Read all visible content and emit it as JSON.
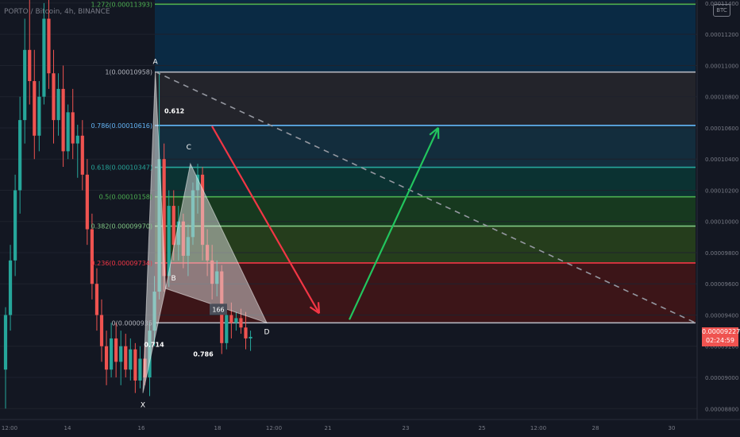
{
  "header": {
    "symbol": "PORTO / Bitcoin, 4h, BINANCE"
  },
  "axis": {
    "currency_badge": "BTC",
    "price_ticks": [
      "0.00011400",
      "0.00011200",
      "0.00011000",
      "0.00010800",
      "0.00010600",
      "0.00010400",
      "0.00010200",
      "0.00010000",
      "0.00009800",
      "0.00009600",
      "0.00009400",
      "0.00009200",
      "0.00009000",
      "0.00008800"
    ],
    "time_ticks": [
      "12:00",
      "14",
      "16",
      "18",
      "12:00",
      "21",
      "23",
      "25",
      "12:00",
      "28",
      "30"
    ],
    "last_price": "0.00009227",
    "countdown": "02:24:59"
  },
  "colors": {
    "background": "#131722",
    "up": "#26a69a",
    "down": "#ef5350",
    "arrow_down": "#f23645",
    "arrow_up": "#22c55e",
    "harmonic_fill": "#e0e0e0"
  },
  "chart_data": {
    "type": "candlestick",
    "y_range": [
      8.73e-05,
      0.0001142
    ],
    "fib_levels": [
      {
        "ratio": "1.272",
        "label": "1.272(0.00011393)",
        "value": 0.00011393,
        "line": "#4caf50",
        "fill": "#0a2a44"
      },
      {
        "ratio": "1",
        "label": "1(0.00010958)",
        "value": 0.00010958,
        "line": "#b2b5be",
        "fill": "#0a2a44"
      },
      {
        "ratio": "0.786",
        "label": "0.786(0.00010616)",
        "value": 0.00010616,
        "line": "#64b5f6",
        "fill": "#23242b"
      },
      {
        "ratio": "0.618",
        "label": "0.618(0.00010347)",
        "value": 0.00010347,
        "line": "#26a69a",
        "fill": "#132d3d"
      },
      {
        "ratio": "0.5",
        "label": "0.5(0.00010158)",
        "value": 0.00010158,
        "line": "#4caf50",
        "fill": "#0b3232"
      },
      {
        "ratio": "0.382",
        "label": "0.382(0.00009970)",
        "value": 9.97e-05,
        "line": "#81c784",
        "fill": "#17391f"
      },
      {
        "ratio": "0.236",
        "label": "0.236(0.00009734)",
        "value": 9.734e-05,
        "line": "#f23645",
        "fill": "#253d1c"
      },
      {
        "ratio": "0",
        "label": "0(0.0000935",
        "value": 9.35e-05,
        "line": "#b2b5be",
        "fill": "#3c1518"
      }
    ],
    "harmonic_points": [
      {
        "name": "X",
        "x": 0.0,
        "value": 8.9e-05
      },
      {
        "name": "A",
        "x": 0.6,
        "value": 0.0001096
      },
      {
        "name": "B",
        "x": 1.1,
        "value": 9.57e-05
      },
      {
        "name": "C",
        "x": 2.3,
        "value": 0.0001037
      },
      {
        "name": "D",
        "x": 6.0,
        "value": 9.35e-05
      }
    ],
    "harmonic_ratios": [
      {
        "text": "0.612",
        "anchor": "A"
      },
      {
        "text": "0.714",
        "anchor": "X"
      },
      {
        "text": "0.786",
        "anchor": "D"
      },
      {
        "text": "166",
        "anchor": "D"
      }
    ],
    "candles": [
      {
        "o": 9.05e-05,
        "h": 9.45e-05,
        "l": 8.8e-05,
        "c": 9.4e-05
      },
      {
        "o": 9.4e-05,
        "h": 9.85e-05,
        "l": 9.3e-05,
        "c": 9.75e-05
      },
      {
        "o": 9.75e-05,
        "h": 0.000103,
        "l": 9.65e-05,
        "c": 0.000102
      },
      {
        "o": 0.000102,
        "h": 0.000108,
        "l": 0.0001005,
        "c": 0.0001065
      },
      {
        "o": 0.0001065,
        "h": 0.000113,
        "l": 0.000105,
        "c": 0.000111
      },
      {
        "o": 0.000111,
        "h": 0.0001145,
        "l": 0.0001075,
        "c": 0.000109
      },
      {
        "o": 0.000109,
        "h": 0.000111,
        "l": 0.000104,
        "c": 0.0001055
      },
      {
        "o": 0.0001055,
        "h": 0.000109,
        "l": 0.0001045,
        "c": 0.000108
      },
      {
        "o": 0.000108,
        "h": 0.000114,
        "l": 0.0001075,
        "c": 0.000113
      },
      {
        "o": 0.000113,
        "h": 0.0001142,
        "l": 0.0001085,
        "c": 0.0001095
      },
      {
        "o": 0.0001095,
        "h": 0.000111,
        "l": 0.000105,
        "c": 0.0001065
      },
      {
        "o": 0.0001065,
        "h": 0.0001095,
        "l": 0.0001055,
        "c": 0.0001085
      },
      {
        "o": 0.0001085,
        "h": 0.00011,
        "l": 0.0001035,
        "c": 0.0001045
      },
      {
        "o": 0.0001045,
        "h": 0.0001075,
        "l": 0.000104,
        "c": 0.000107
      },
      {
        "o": 0.000107,
        "h": 0.0001085,
        "l": 0.000104,
        "c": 0.000105
      },
      {
        "o": 0.000105,
        "h": 0.0001062,
        "l": 0.0001028,
        "c": 0.0001055
      },
      {
        "o": 0.0001055,
        "h": 0.0001065,
        "l": 0.000102,
        "c": 0.000103
      },
      {
        "o": 0.000103,
        "h": 0.000104,
        "l": 9.85e-05,
        "c": 9.95e-05
      },
      {
        "o": 9.95e-05,
        "h": 0.0001005,
        "l": 9.5e-05,
        "c": 9.6e-05
      },
      {
        "o": 9.6e-05,
        "h": 9.7e-05,
        "l": 9.3e-05,
        "c": 9.4e-05
      },
      {
        "o": 9.4e-05,
        "h": 9.5e-05,
        "l": 9.1e-05,
        "c": 9.2e-05
      },
      {
        "o": 9.2e-05,
        "h": 9.3e-05,
        "l": 8.95e-05,
        "c": 9.05e-05
      },
      {
        "o": 9.05e-05,
        "h": 9.35e-05,
        "l": 9e-05,
        "c": 9.25e-05
      },
      {
        "o": 9.25e-05,
        "h": 9.35e-05,
        "l": 9e-05,
        "c": 9.1e-05
      },
      {
        "o": 9.1e-05,
        "h": 9.3e-05,
        "l": 8.95e-05,
        "c": 9.2e-05
      },
      {
        "o": 9.2e-05,
        "h": 9.28e-05,
        "l": 9e-05,
        "c": 9.05e-05
      },
      {
        "o": 9.05e-05,
        "h": 9.25e-05,
        "l": 8.98e-05,
        "c": 9.18e-05
      },
      {
        "o": 9.18e-05,
        "h": 9.22e-05,
        "l": 8.9e-05,
        "c": 8.98e-05
      },
      {
        "o": 8.98e-05,
        "h": 9.2e-05,
        "l": 8.93e-05,
        "c": 9.12e-05
      },
      {
        "o": 9.12e-05,
        "h": 9.2e-05,
        "l": 8.95e-05,
        "c": 9e-05
      },
      {
        "o": 9e-05,
        "h": 9.35e-05,
        "l": 8.88e-05,
        "c": 9.3e-05
      },
      {
        "o": 9.3e-05,
        "h": 9.65e-05,
        "l": 9.2e-05,
        "c": 9.55e-05
      },
      {
        "o": 9.55e-05,
        "h": 0.0001096,
        "l": 9.5e-05,
        "c": 0.000104
      },
      {
        "o": 0.000104,
        "h": 0.000105,
        "l": 9.55e-05,
        "c": 9.65e-05
      },
      {
        "o": 9.65e-05,
        "h": 0.000102,
        "l": 9.58e-05,
        "c": 0.000101
      },
      {
        "o": 0.000101,
        "h": 0.000102,
        "l": 9.75e-05,
        "c": 9.85e-05
      },
      {
        "o": 9.85e-05,
        "h": 0.000101,
        "l": 9.75e-05,
        "c": 0.0001
      },
      {
        "o": 0.0001,
        "h": 0.0001005,
        "l": 9.7e-05,
        "c": 9.78e-05
      },
      {
        "o": 9.78e-05,
        "h": 9.98e-05,
        "l": 9.65e-05,
        "c": 9.9e-05
      },
      {
        "o": 9.9e-05,
        "h": 0.0001025,
        "l": 9.85e-05,
        "c": 0.000102
      },
      {
        "o": 0.000102,
        "h": 0.0001037,
        "l": 0.0001005,
        "c": 0.000103
      },
      {
        "o": 0.000103,
        "h": 0.0001035,
        "l": 9.75e-05,
        "c": 9.85e-05
      },
      {
        "o": 9.85e-05,
        "h": 9.95e-05,
        "l": 9.65e-05,
        "c": 9.75e-05
      },
      {
        "o": 9.75e-05,
        "h": 9.85e-05,
        "l": 9.5e-05,
        "c": 9.6e-05
      },
      {
        "o": 9.6e-05,
        "h": 9.75e-05,
        "l": 9.52e-05,
        "c": 9.68e-05
      },
      {
        "o": 9.68e-05,
        "h": 9.72e-05,
        "l": 9.15e-05,
        "c": 9.22e-05
      },
      {
        "o": 9.22e-05,
        "h": 9.45e-05,
        "l": 9.18e-05,
        "c": 9.4e-05
      },
      {
        "o": 9.4e-05,
        "h": 9.48e-05,
        "l": 9.25e-05,
        "c": 9.35e-05
      },
      {
        "o": 9.35e-05,
        "h": 9.42e-05,
        "l": 9.3e-05,
        "c": 9.38e-05
      },
      {
        "o": 9.38e-05,
        "h": 9.44e-05,
        "l": 9.28e-05,
        "c": 9.32e-05
      },
      {
        "o": 9.32e-05,
        "h": 9.42e-05,
        "l": 9.18e-05,
        "c": 9.25e-05
      },
      {
        "o": 9.25e-05,
        "h": 9.3e-05,
        "l": 9.17e-05,
        "c": 9.26e-05
      }
    ]
  }
}
